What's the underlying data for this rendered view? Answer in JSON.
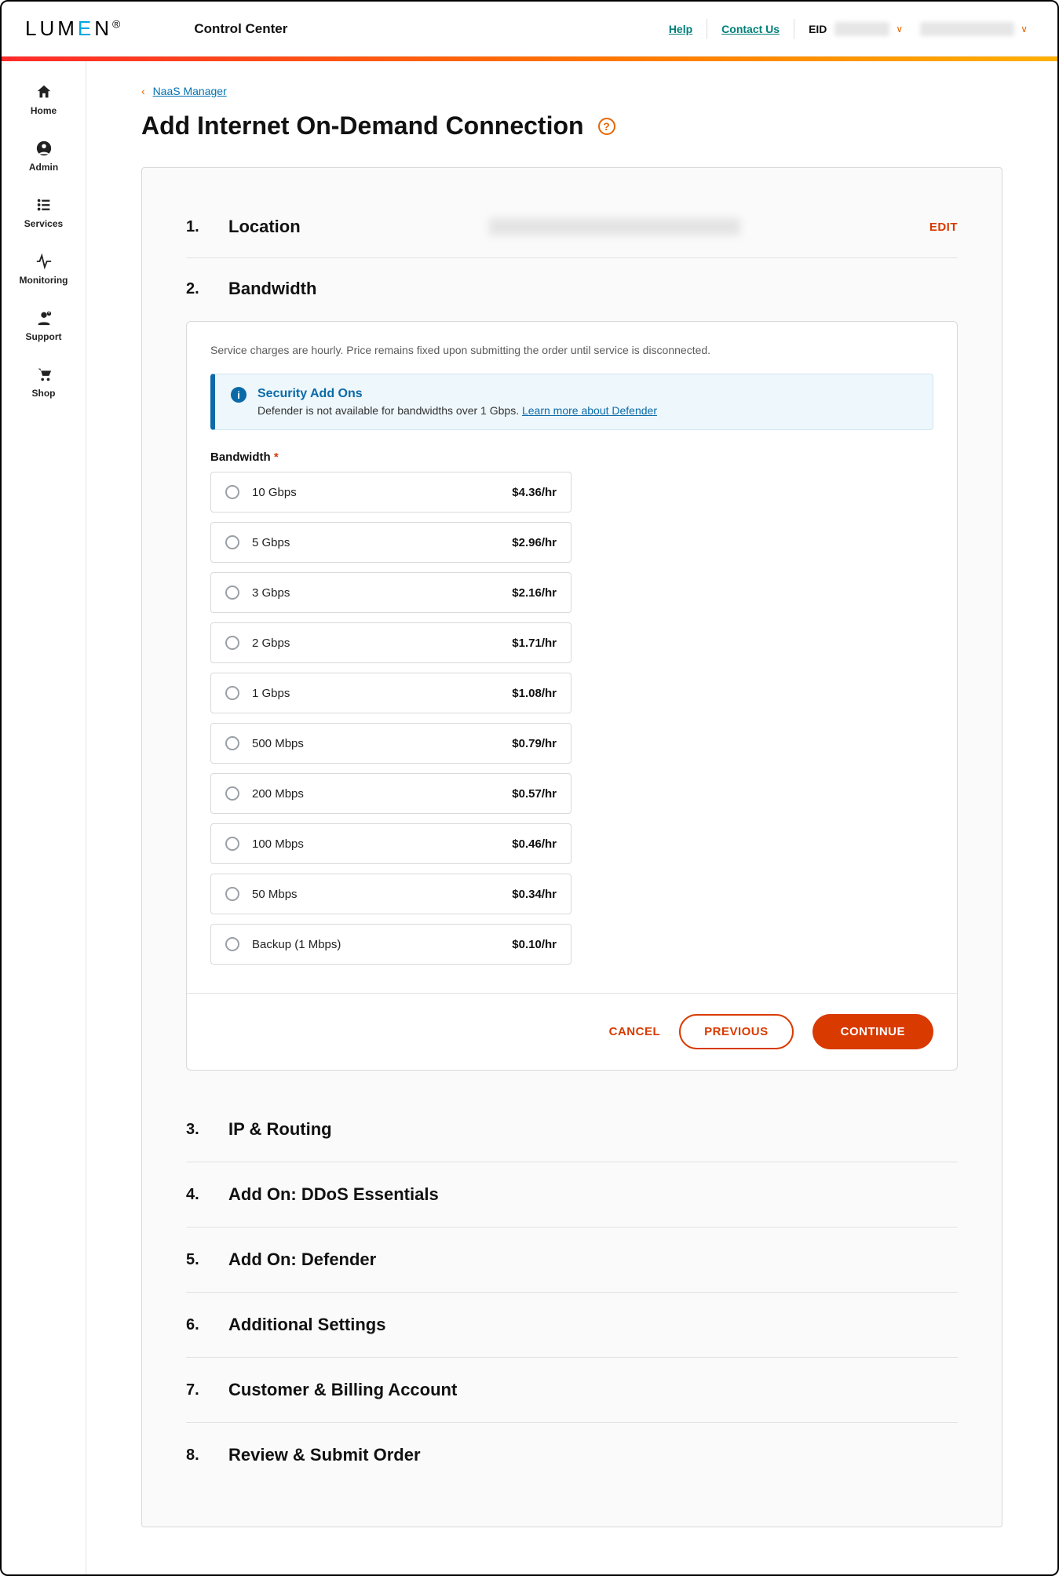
{
  "header": {
    "logo": "LUMEN",
    "app_title": "Control Center",
    "help": "Help",
    "contact": "Contact Us",
    "eid_label": "EID"
  },
  "sidebar": {
    "items": [
      {
        "label": "Home"
      },
      {
        "label": "Admin"
      },
      {
        "label": "Services"
      },
      {
        "label": "Monitoring"
      },
      {
        "label": "Support"
      },
      {
        "label": "Shop"
      }
    ]
  },
  "breadcrumb": {
    "label": "NaaS Manager"
  },
  "page": {
    "title": "Add Internet On-Demand Connection"
  },
  "steps": {
    "s1": {
      "num": "1.",
      "title": "Location",
      "edit": "EDIT"
    },
    "s2": {
      "num": "2.",
      "title": "Bandwidth"
    },
    "s3": {
      "num": "3.",
      "title": "IP & Routing"
    },
    "s4": {
      "num": "4.",
      "title": "Add On: DDoS Essentials"
    },
    "s5": {
      "num": "5.",
      "title": "Add On: Defender"
    },
    "s6": {
      "num": "6.",
      "title": "Additional Settings"
    },
    "s7": {
      "num": "7.",
      "title": "Customer & Billing Account"
    },
    "s8": {
      "num": "8.",
      "title": "Review & Submit Order"
    }
  },
  "bandwidth": {
    "note": "Service charges are hourly. Price remains fixed upon submitting the order until service is disconnected.",
    "callout": {
      "title": "Security Add Ons",
      "body_prefix": "Defender is not available for bandwidths over 1 Gbps. ",
      "link": "Learn more about Defender"
    },
    "field_label": "Bandwidth",
    "options": [
      {
        "label": "10 Gbps",
        "price": "$4.36/hr"
      },
      {
        "label": "5 Gbps",
        "price": "$2.96/hr"
      },
      {
        "label": "3 Gbps",
        "price": "$2.16/hr"
      },
      {
        "label": "2 Gbps",
        "price": "$1.71/hr"
      },
      {
        "label": "1 Gbps",
        "price": "$1.08/hr"
      },
      {
        "label": "500 Mbps",
        "price": "$0.79/hr"
      },
      {
        "label": "200 Mbps",
        "price": "$0.57/hr"
      },
      {
        "label": "100 Mbps",
        "price": "$0.46/hr"
      },
      {
        "label": "50 Mbps",
        "price": "$0.34/hr"
      },
      {
        "label": "Backup (1 Mbps)",
        "price": "$0.10/hr"
      }
    ]
  },
  "actions": {
    "cancel": "CANCEL",
    "previous": "PREVIOUS",
    "continue": "CONTINUE"
  }
}
